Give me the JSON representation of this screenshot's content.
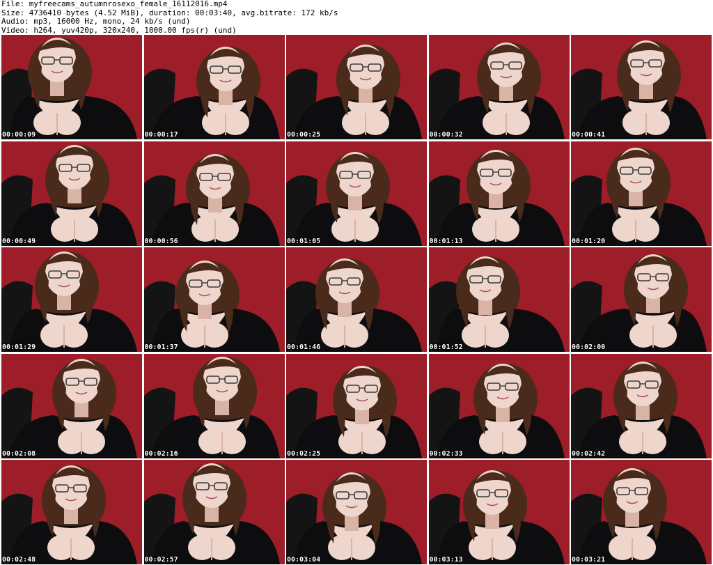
{
  "header": {
    "file_line": "File: myfreecams_autumnrosexo_female_16112016.mp4",
    "size_line": "Size: 4736410 bytes (4.52 MiB), duration: 00:03:40, avg.bitrate: 172 kb/s",
    "audio_line": "Audio: mp3, 16000 Hz, mono, 24 kb/s (und)",
    "video_line": "Video: h264, yuv420p, 320x240, 1000.00 fps(r) (und)"
  },
  "colors": {
    "wall": "#b0232f",
    "wall_dark": "#7a1420",
    "chair": "#141414",
    "top": "#0d0d0f",
    "skin": "#eed6cc",
    "skin_shade": "#d9b3a6",
    "hair": "#4a2a1a",
    "glasses": "#3a3a3a"
  },
  "thumbnails": [
    {
      "time": "00:00:09",
      "icon": "video-frame-icon"
    },
    {
      "time": "00:00:17",
      "icon": "video-frame-icon"
    },
    {
      "time": "00:00:25",
      "icon": "video-frame-icon"
    },
    {
      "time": "00:00:32",
      "icon": "video-frame-icon"
    },
    {
      "time": "00:00:41",
      "icon": "video-frame-icon"
    },
    {
      "time": "00:00:49",
      "icon": "video-frame-icon"
    },
    {
      "time": "00:00:56",
      "icon": "video-frame-icon"
    },
    {
      "time": "00:01:05",
      "icon": "video-frame-icon"
    },
    {
      "time": "00:01:13",
      "icon": "video-frame-icon"
    },
    {
      "time": "00:01:20",
      "icon": "video-frame-icon"
    },
    {
      "time": "00:01:29",
      "icon": "video-frame-icon"
    },
    {
      "time": "00:01:37",
      "icon": "video-frame-icon"
    },
    {
      "time": "00:01:46",
      "icon": "video-frame-icon"
    },
    {
      "time": "00:01:52",
      "icon": "video-frame-icon"
    },
    {
      "time": "00:02:00",
      "icon": "video-frame-icon"
    },
    {
      "time": "00:02:08",
      "icon": "video-frame-icon"
    },
    {
      "time": "00:02:16",
      "icon": "video-frame-icon"
    },
    {
      "time": "00:02:25",
      "icon": "video-frame-icon"
    },
    {
      "time": "00:02:33",
      "icon": "video-frame-icon"
    },
    {
      "time": "00:02:42",
      "icon": "video-frame-icon"
    },
    {
      "time": "00:02:48",
      "icon": "video-frame-icon"
    },
    {
      "time": "00:02:57",
      "icon": "video-frame-icon"
    },
    {
      "time": "00:03:04",
      "icon": "video-frame-icon"
    },
    {
      "time": "00:03:13",
      "icon": "video-frame-icon"
    },
    {
      "time": "00:03:21",
      "icon": "video-frame-icon"
    }
  ]
}
